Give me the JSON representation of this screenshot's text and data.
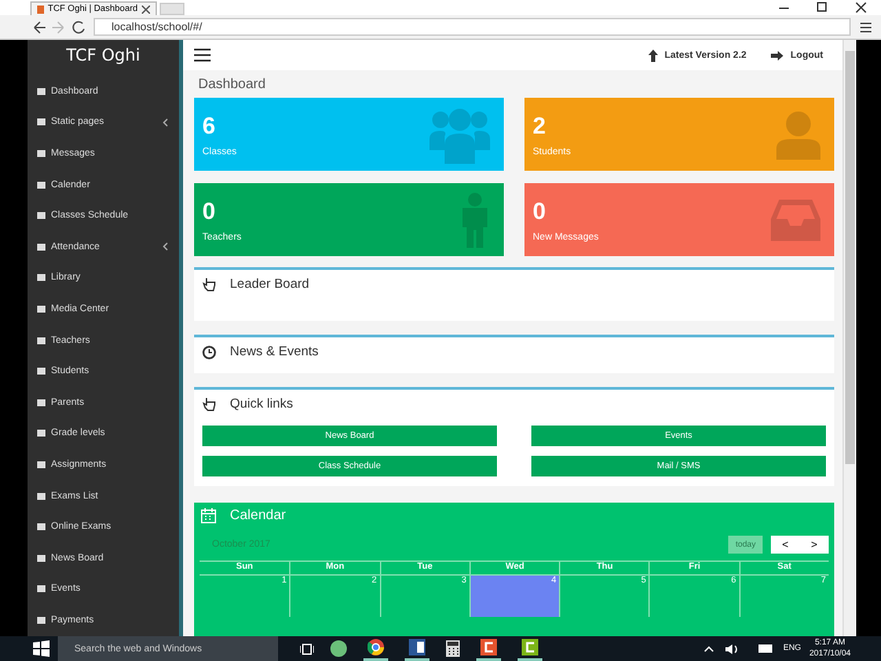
{
  "browser": {
    "tab_title": "TCF Oghi | Dashboard",
    "address": "localhost/school/#/"
  },
  "sidebar": {
    "title": "TCF Oghi",
    "items": [
      {
        "label": "Dashboard",
        "has_submenu": false
      },
      {
        "label": "Static pages",
        "has_submenu": true
      },
      {
        "label": "Messages",
        "has_submenu": false
      },
      {
        "label": "Calender",
        "has_submenu": false
      },
      {
        "label": "Classes Schedule",
        "has_submenu": false
      },
      {
        "label": "Attendance",
        "has_submenu": true
      },
      {
        "label": "Library",
        "has_submenu": false
      },
      {
        "label": "Media Center",
        "has_submenu": false
      },
      {
        "label": "Teachers",
        "has_submenu": false
      },
      {
        "label": "Students",
        "has_submenu": false
      },
      {
        "label": "Parents",
        "has_submenu": false
      },
      {
        "label": "Grade levels",
        "has_submenu": false
      },
      {
        "label": "Assignments",
        "has_submenu": false
      },
      {
        "label": "Exams List",
        "has_submenu": false
      },
      {
        "label": "Online Exams",
        "has_submenu": false
      },
      {
        "label": "News Board",
        "has_submenu": false
      },
      {
        "label": "Events",
        "has_submenu": false
      },
      {
        "label": "Payments",
        "has_submenu": false
      }
    ]
  },
  "header": {
    "version": "Latest Version 2.2",
    "logout": "Logout"
  },
  "page_title": "Dashboard",
  "stats": [
    {
      "count": "6",
      "label": "Classes",
      "color": "#00c0ef",
      "kind": "group"
    },
    {
      "count": "2",
      "label": "Students",
      "color": "#f39c12",
      "kind": "person"
    },
    {
      "count": "0",
      "label": "Teachers",
      "color": "#00a65a",
      "kind": "figure"
    },
    {
      "count": "0",
      "label": "New Messages",
      "color": "#f56954",
      "kind": "inbox"
    }
  ],
  "panels": [
    {
      "title": "Leader Board",
      "kind": "hand"
    },
    {
      "title": "News & Events",
      "kind": "clock"
    }
  ],
  "quick_links": {
    "title": "Quick links",
    "links": [
      "News Board",
      "Events",
      "Class Schedule",
      "Mail / SMS"
    ]
  },
  "calendar": {
    "title": "Calendar",
    "month": "October 2017",
    "today": "today",
    "prev": "<",
    "next": ">",
    "weekdays": [
      "Sun",
      "Mon",
      "Tue",
      "Wed",
      "Thu",
      "Fri",
      "Sat"
    ],
    "days": [
      {
        "day": "1",
        "selected": false
      },
      {
        "day": "2",
        "selected": false
      },
      {
        "day": "3",
        "selected": false
      },
      {
        "day": "4",
        "selected": true
      },
      {
        "day": "5",
        "selected": false
      },
      {
        "day": "6",
        "selected": false
      },
      {
        "day": "7",
        "selected": false
      }
    ]
  },
  "taskbar": {
    "search": "Search the web and Windows",
    "language": "ENG",
    "time": "5:17 AM",
    "date": "2017/10/04"
  }
}
